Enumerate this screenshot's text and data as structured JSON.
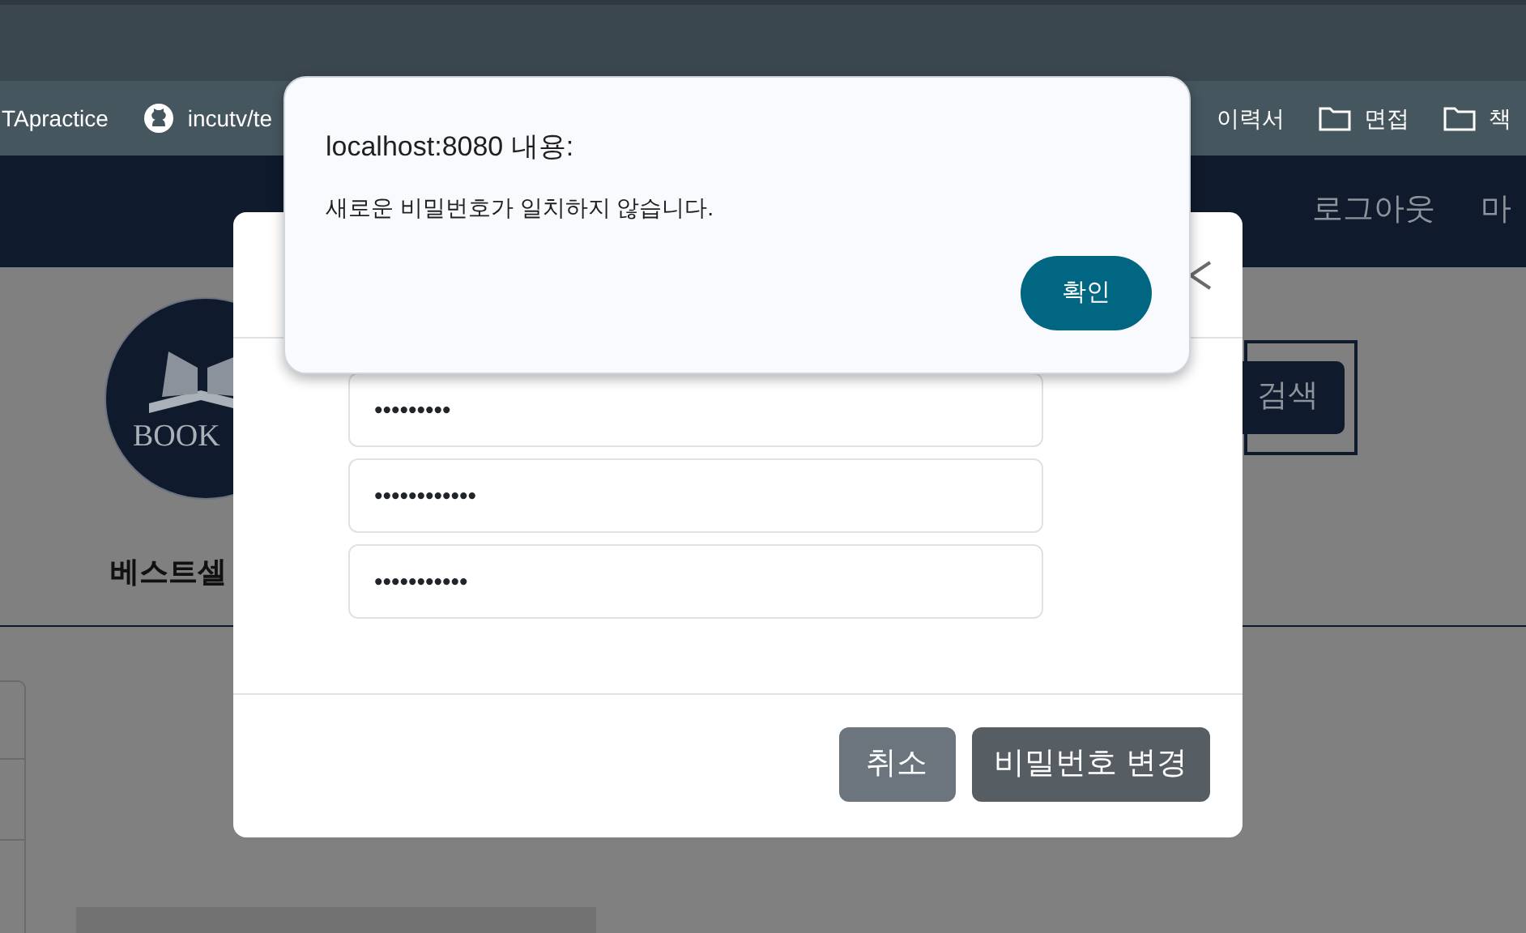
{
  "bookmarks": [
    {
      "label": "TApractice",
      "kind": "plain"
    },
    {
      "label": "incutv/te",
      "kind": "github"
    },
    {
      "label": "이력서",
      "kind": "plain"
    },
    {
      "label": "면접",
      "kind": "folder"
    },
    {
      "label": "책",
      "kind": "folder"
    }
  ],
  "navbar": {
    "links": [
      "로그아웃",
      "마"
    ]
  },
  "page": {
    "logo_text": "BOOK",
    "search_button": "검색",
    "section_heading": "베스트셀"
  },
  "modal": {
    "fields": [
      {
        "value": "•••••••••"
      },
      {
        "value": "••••••••••••"
      },
      {
        "value": "•••••••••••"
      }
    ],
    "buttons": [
      {
        "label": "취소",
        "kind": "secondary"
      },
      {
        "label": "비밀번호 변경",
        "kind": "dark"
      }
    ]
  },
  "alert": {
    "title": "localhost:8080 내용:",
    "message": "새로운 비밀번호가 일치하지 않습니다.",
    "button": "확인"
  }
}
